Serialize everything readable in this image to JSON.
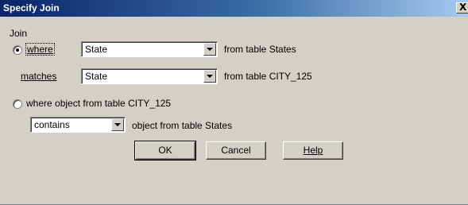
{
  "window": {
    "title": "Specify Join",
    "close_label": "X"
  },
  "join": {
    "group_label": "Join",
    "option_where": {
      "label": "where",
      "selected": true,
      "field_value": "State",
      "from_text": "from table States"
    },
    "matches": {
      "label": "matches",
      "field_value": "State",
      "from_text": "from table CITY_125"
    },
    "option_object": {
      "label": "where object from table CITY_125",
      "selected": false,
      "relation_value": "contains",
      "object_text": "object from table States"
    }
  },
  "buttons": {
    "ok": "OK",
    "cancel": "Cancel",
    "help": "Help"
  }
}
